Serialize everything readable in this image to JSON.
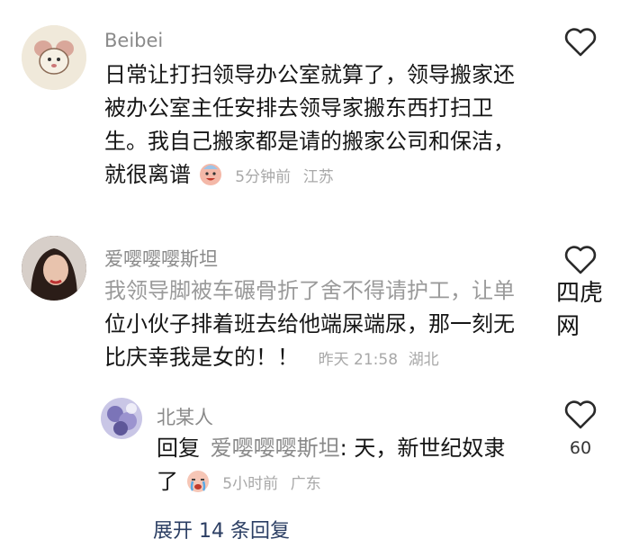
{
  "comments": [
    {
      "author": "Beibei",
      "lines": [
        "日常让打扫领导办公室就算了，领导搬家还",
        "被办公室主任安排去领导家搬东西打扫卫",
        "生。我自己搬家都是请的搬家公司和保洁，",
        "就很离谱"
      ],
      "time": "5分钟前",
      "location": "江苏"
    },
    {
      "author": "爱嘤嘤嘤斯坦",
      "lines": [
        "我领导脚被车碾骨折了舍不得请护工，让单",
        "位小伙子排着班去给他端屎端尿，那一刻无",
        "比庆幸我是女的！！"
      ],
      "time": "昨天 21:58",
      "location": "湖北"
    }
  ],
  "reply": {
    "author": "北某人",
    "prefix": "回复",
    "reply_to": "爱嘤嘤嘤斯坦",
    "line1_rest": ": 天，新世纪奴隶",
    "line2": "了",
    "time": "5小时前",
    "location": "广东",
    "likes": "60"
  },
  "expand_label": "展开 14 条回复",
  "watermark": "四虎网",
  "icons": [
    "heart-icon",
    "grinning-face-icon",
    "crying-face-icon"
  ]
}
